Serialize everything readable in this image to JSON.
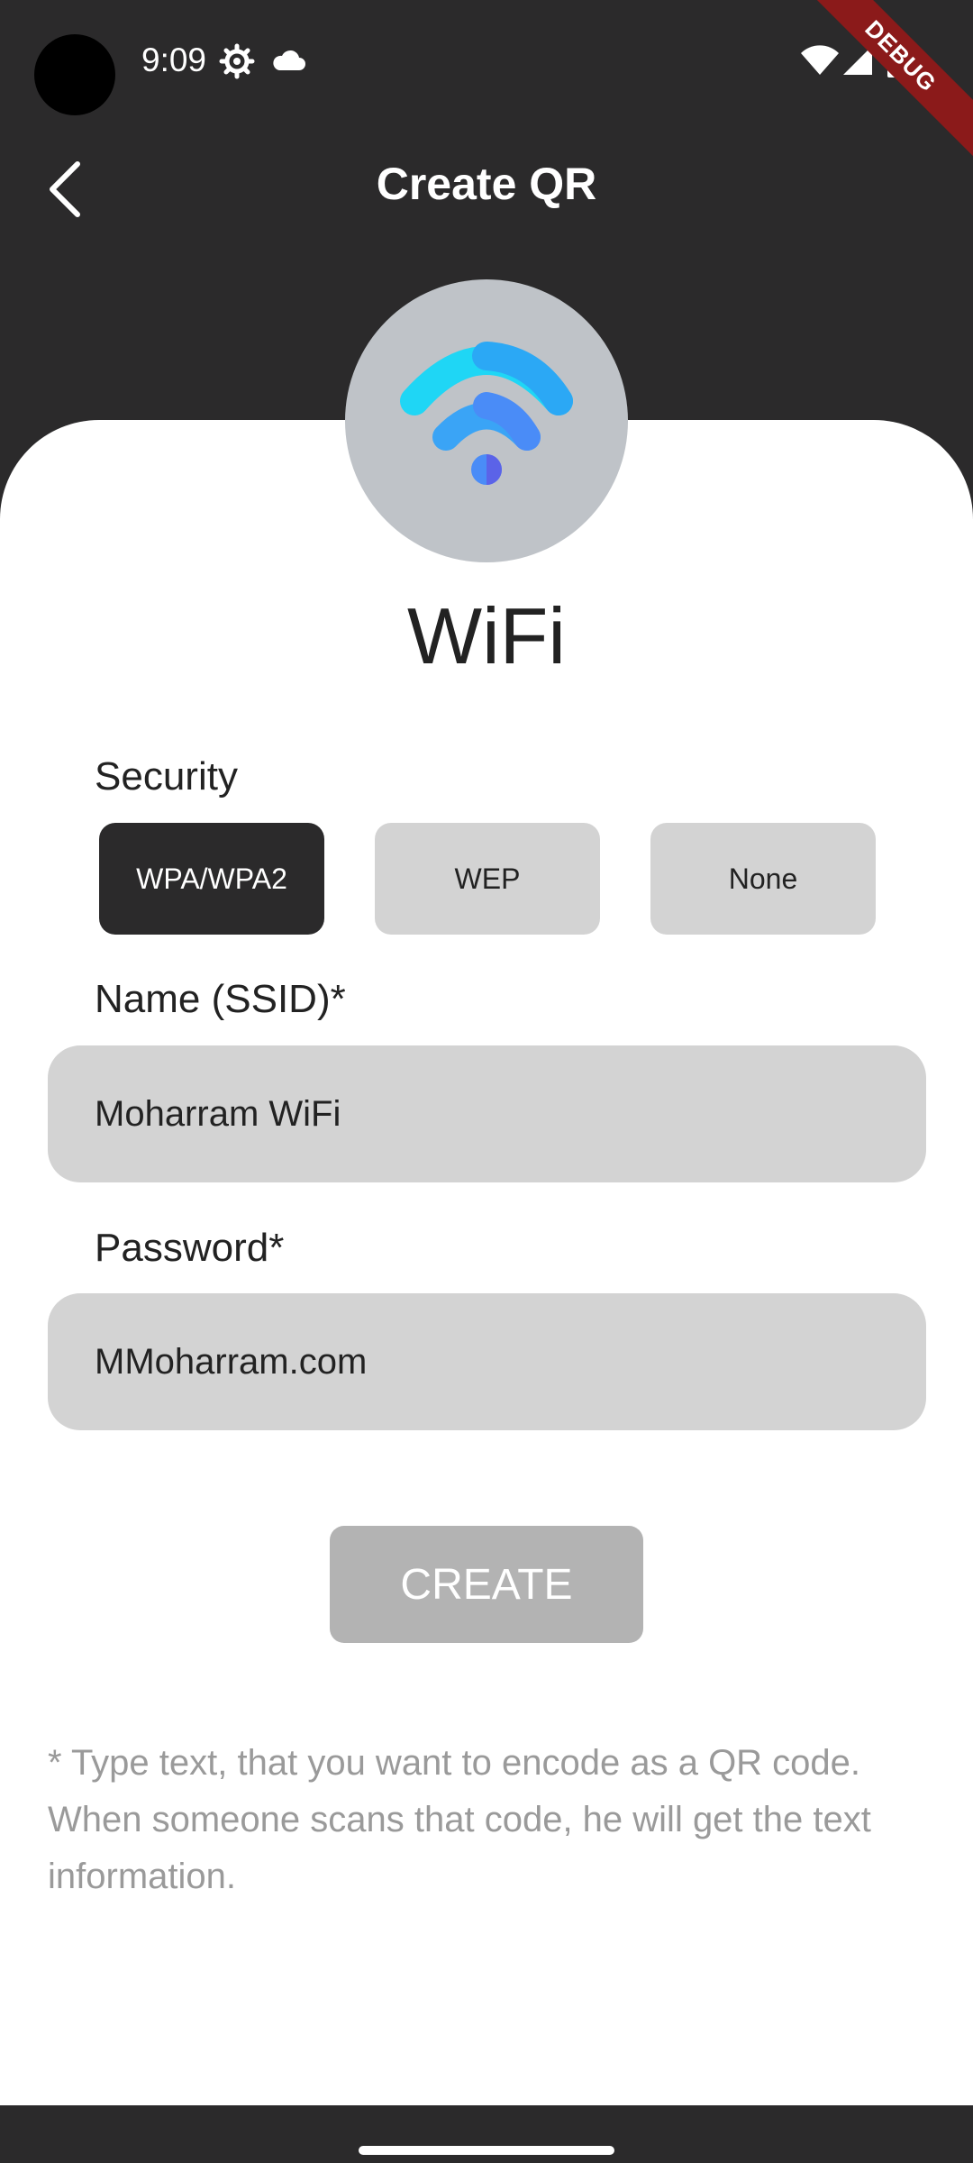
{
  "status_bar": {
    "time": "9:09",
    "icons": [
      "settings-icon",
      "cloud-icon",
      "wifi-signal-icon",
      "cell-signal-icon",
      "battery-icon"
    ],
    "debug_label": "DEBUG"
  },
  "app_bar": {
    "title": "Create QR",
    "back_icon": "chevron-left-icon"
  },
  "qr_type": {
    "icon": "wifi-icon",
    "title": "WiFi"
  },
  "security": {
    "label": "Security",
    "options": [
      "WPA/WPA2",
      "WEP",
      "None"
    ],
    "selected": "WPA/WPA2"
  },
  "ssid": {
    "label": "Name (SSID)*",
    "value": "Moharram WiFi"
  },
  "password": {
    "label": "Password*",
    "value": "MMoharram.com"
  },
  "create_button": {
    "label": "CREATE"
  },
  "help_text": "* Type text, that you want to encode as a QR code. When someone scans that code, he will get the text information.",
  "colors": {
    "dark": "#2b2a2b",
    "field_bg": "#d3d3d3",
    "avatar_bg": "#bfc3c8",
    "button_disabled": "#b3b3b3",
    "wifi_cyan": "#1fd6f5",
    "wifi_blue": "#4a8cf7",
    "wifi_violet": "#5b63e8"
  }
}
